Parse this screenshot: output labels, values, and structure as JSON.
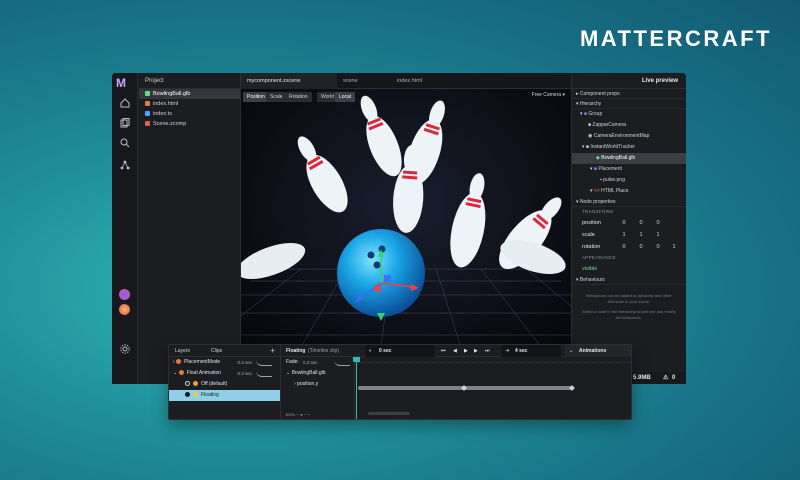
{
  "brand": "MATTERCRAFT",
  "rail": {
    "logo": "M",
    "icons": [
      "home-icon",
      "files-icon",
      "search-icon",
      "graph-icon",
      "user-avatar",
      "user-avatar-2",
      "settings-icon"
    ]
  },
  "project": {
    "title": "Project",
    "files": [
      {
        "name": "BowlingBall.glb",
        "color": "#6bdc8a"
      },
      {
        "name": "index.html",
        "color": "#e07b47"
      },
      {
        "name": "index.ts",
        "color": "#4aa3ff"
      },
      {
        "name": "Scene.zcomp",
        "color": "#e05d5d"
      }
    ]
  },
  "tabs": [
    {
      "label": "mycomponent.zscene"
    },
    {
      "label": "scene"
    },
    {
      "label": "index.html"
    }
  ],
  "viewport": {
    "tools": [
      "Position",
      "Scale",
      "Rotation",
      "World",
      "Local"
    ],
    "camera": "Free Camera"
  },
  "right": {
    "live_preview": "Live preview",
    "component_props": "Component props",
    "hierarchy_label": "Hierarchy",
    "hierarchy": [
      {
        "label": "Group",
        "indent": 1
      },
      {
        "label": "ZapparCamera",
        "indent": 2
      },
      {
        "label": "CameraEnvironmentMap",
        "indent": 2
      },
      {
        "label": "InstantWorldTracker",
        "indent": 2
      },
      {
        "label": "BowlingBall.glb",
        "indent": 3
      },
      {
        "label": "Placement",
        "indent": 3
      },
      {
        "label": "pulse.png",
        "indent": 3
      },
      {
        "label": "HTML Place",
        "indent": 3
      }
    ],
    "node_props_label": "Node properties",
    "transform_label": "TRANSFORM",
    "transform": [
      {
        "name": "position",
        "values": [
          "0",
          "0",
          "0"
        ]
      },
      {
        "name": "scale",
        "values": [
          "1",
          "1",
          "1"
        ]
      },
      {
        "name": "rotation",
        "values": [
          "0",
          "0",
          "0",
          "1"
        ]
      }
    ],
    "appearance_label": "APPEARANCE",
    "visible": "visible",
    "behaviours_label": "Behaviours",
    "behaviours_hint": "Behaviours can be added to hierarchy and other elements in your scene.",
    "behaviours_hint2": "Select a node in the Hierarchy to add one and modify its behaviours.",
    "filesize": "5.9MB",
    "warnings": "0"
  },
  "timeline": {
    "tab_layers": "Layers",
    "tab_clips": "Clips",
    "add": "+",
    "clip_title": "Floating",
    "clip_sub": "(Timeline clip)",
    "time_start": "0 sec",
    "time_end": "4 sec",
    "animations_label": "Animations",
    "fade_label": "Fade:",
    "fade_value": "0.3 sec",
    "track_object": "BowlingBall.glb",
    "track_prop": "position.y",
    "zoom": "100%",
    "layers": [
      {
        "label": "PlacementMode",
        "dur": "0.3 sec",
        "color": "#e8763a",
        "indent": 1
      },
      {
        "label": "Float Animation",
        "dur": "0.3 sec",
        "color": "#e8763a",
        "indent": 1
      },
      {
        "label": "Off (default)",
        "dur": "",
        "color": "#e8a23a",
        "indent": 2
      },
      {
        "label": "Floating",
        "dur": "",
        "color": "#f2c84a",
        "indent": 2
      }
    ]
  }
}
